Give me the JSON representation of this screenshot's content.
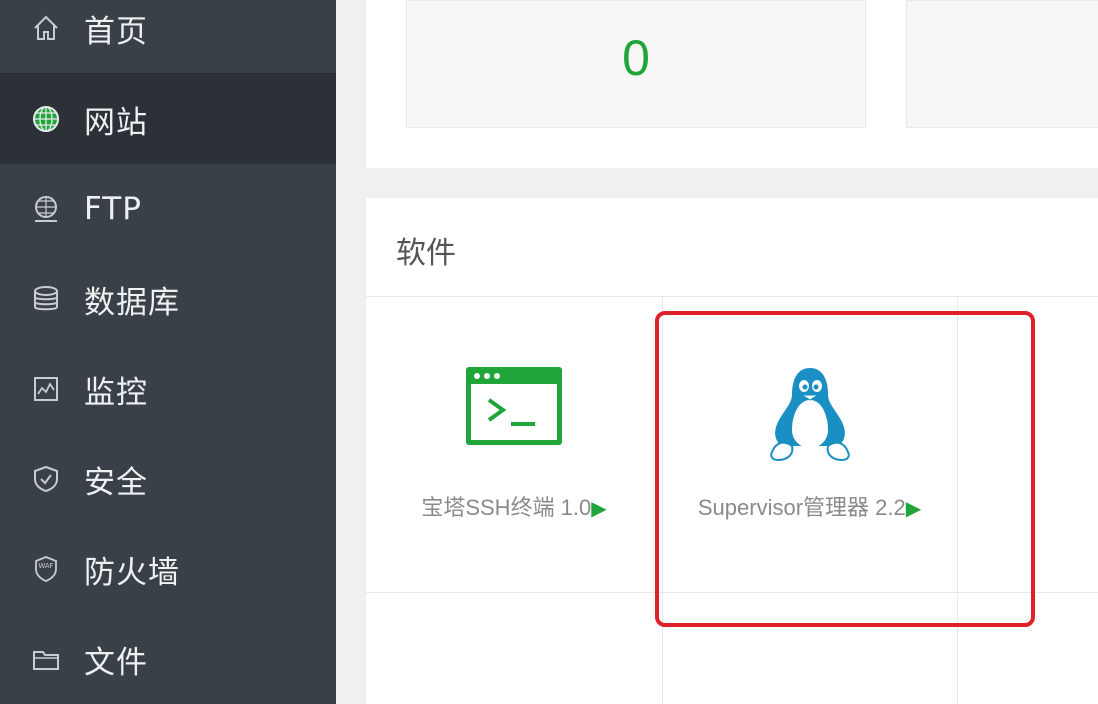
{
  "sidebar": {
    "items": [
      {
        "label": "首页",
        "icon": "home-icon"
      },
      {
        "label": "网站",
        "icon": "globe-icon",
        "active": true
      },
      {
        "label": "FTP",
        "icon": "ftp-server-icon"
      },
      {
        "label": "数据库",
        "icon": "database-icon"
      },
      {
        "label": "监控",
        "icon": "monitor-chart-icon"
      },
      {
        "label": "安全",
        "icon": "shield-icon"
      },
      {
        "label": "防火墙",
        "icon": "waf-shield-icon",
        "icon_text": "WAF"
      },
      {
        "label": "文件",
        "icon": "folder-icon"
      }
    ]
  },
  "stats": {
    "card1_value": "0"
  },
  "software": {
    "title": "软件",
    "items": [
      {
        "name": "宝塔SSH终端 1.0",
        "arrow": "▶",
        "icon": "terminal-icon"
      },
      {
        "name": "Supervisor管理器 2.2",
        "arrow": "▶",
        "icon": "linux-penguin-icon"
      }
    ]
  },
  "colors": {
    "sidebar_bg": "#3a4047",
    "sidebar_active": "#2c3137",
    "accent_green": "#20a53a",
    "highlight_red": "#e0202a"
  }
}
